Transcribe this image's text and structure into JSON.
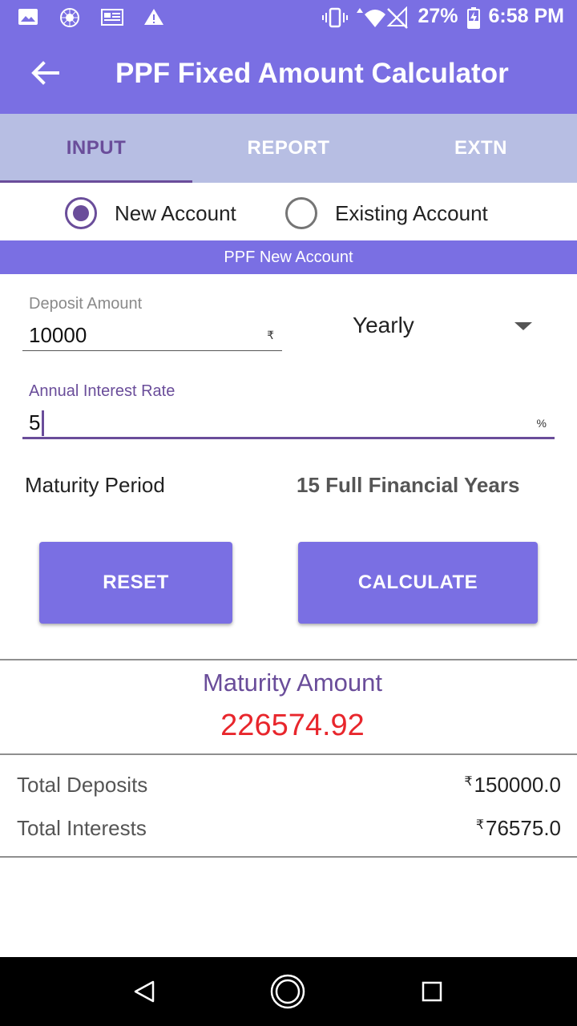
{
  "status_bar": {
    "battery": "27%",
    "time": "6:58 PM"
  },
  "app_bar": {
    "title": "PPF Fixed Amount Calculator"
  },
  "tabs": [
    {
      "label": "INPUT",
      "active": true
    },
    {
      "label": "REPORT",
      "active": false
    },
    {
      "label": "EXTN",
      "active": false
    }
  ],
  "account_type": {
    "options": [
      "New Account",
      "Existing Account"
    ],
    "selected": "New Account"
  },
  "banner": "PPF New Account",
  "deposit": {
    "label": "Deposit Amount",
    "value": "10000",
    "suffix": "₹"
  },
  "frequency": {
    "selected": "Yearly"
  },
  "interest_rate": {
    "label": "Annual Interest Rate",
    "value": "5",
    "suffix": "%"
  },
  "maturity_period": {
    "label": "Maturity Period",
    "value": "15 Full Financial Years"
  },
  "buttons": {
    "reset": "RESET",
    "calculate": "CALCULATE"
  },
  "result": {
    "title": "Maturity Amount",
    "value": "226574.92"
  },
  "summary": [
    {
      "label": "Total Deposits",
      "currency": "₹",
      "value": "150000.0"
    },
    {
      "label": "Total Interests",
      "currency": "₹",
      "value": "76575.0"
    }
  ],
  "colors": {
    "primary": "#7a6fe3",
    "accent": "#6a4d9a",
    "tab_bg": "#b7bee3",
    "result_value": "#e8262c"
  }
}
